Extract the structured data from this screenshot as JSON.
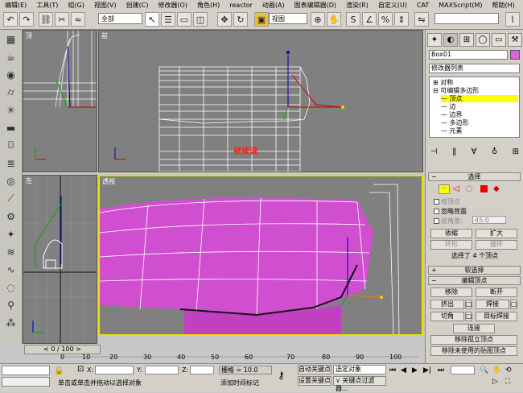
{
  "menu": [
    "编辑(E)",
    "工具(T)",
    "组(G)",
    "视图(V)",
    "创建(C)",
    "修改器(O)",
    "角色(H)",
    "reactor",
    "动画(A)",
    "图表编辑器(D)",
    "渲染(R)",
    "自定义(U)",
    "CAT",
    "MAXScript(M)",
    "帮助(H)"
  ],
  "toolbar": {
    "filter_value": "全部",
    "refcoord_value": "视图"
  },
  "viewports": {
    "top_left_label": "顶",
    "top_right_label": "前",
    "bottom_left_label": "左",
    "bottom_right_label": "透视",
    "annotation": "继续调"
  },
  "right_panel": {
    "object_name": "Box01",
    "modifier_list": "修改器列表",
    "stack_items": [
      "对称",
      "可编辑多边形",
      "顶点",
      "边",
      "边界",
      "多边形",
      "元素"
    ],
    "selected_item": "顶点",
    "rollout_select_title": "选择",
    "by_vertex": "按顶点",
    "ignore_backfacing": "忽略背面",
    "by_angle": "按角度:",
    "angle_value": "45.0",
    "shrink": "收缩",
    "grow": "扩大",
    "ring": "环形",
    "loop": "循环",
    "selection_info": "选择了 4 个顶点",
    "soft_select_title": "软选择",
    "edit_vertices_title": "编辑顶点",
    "remove": "移除",
    "break": "断开",
    "extrude": "挤出",
    "weld": "焊接",
    "chamfer": "切角",
    "target_weld": "目标焊接",
    "connect": "连接",
    "remove_isolated": "移除孤立顶点",
    "remove_unused_map": "移除未使用的贴图顶点",
    "accent_color": "#e060e0",
    "highlight_color": "#ffff00"
  },
  "timeline": {
    "frame_counter": "0 / 100",
    "ticks": [
      "0",
      "10",
      "20",
      "30",
      "40",
      "50",
      "60",
      "70",
      "80",
      "90",
      "100"
    ]
  },
  "status": {
    "x_label": "X:",
    "y_label": "Y:",
    "z_label": "Z:",
    "grid": "栅格 = 10.0",
    "auto_key": "自动关键点",
    "selected_object": "选定对象",
    "set_key": "设置关键点",
    "key_filter": "关键点过滤器...",
    "prompt": "单击或单击并拖动以选择对象",
    "add_time_tag": "添加时间标记"
  }
}
